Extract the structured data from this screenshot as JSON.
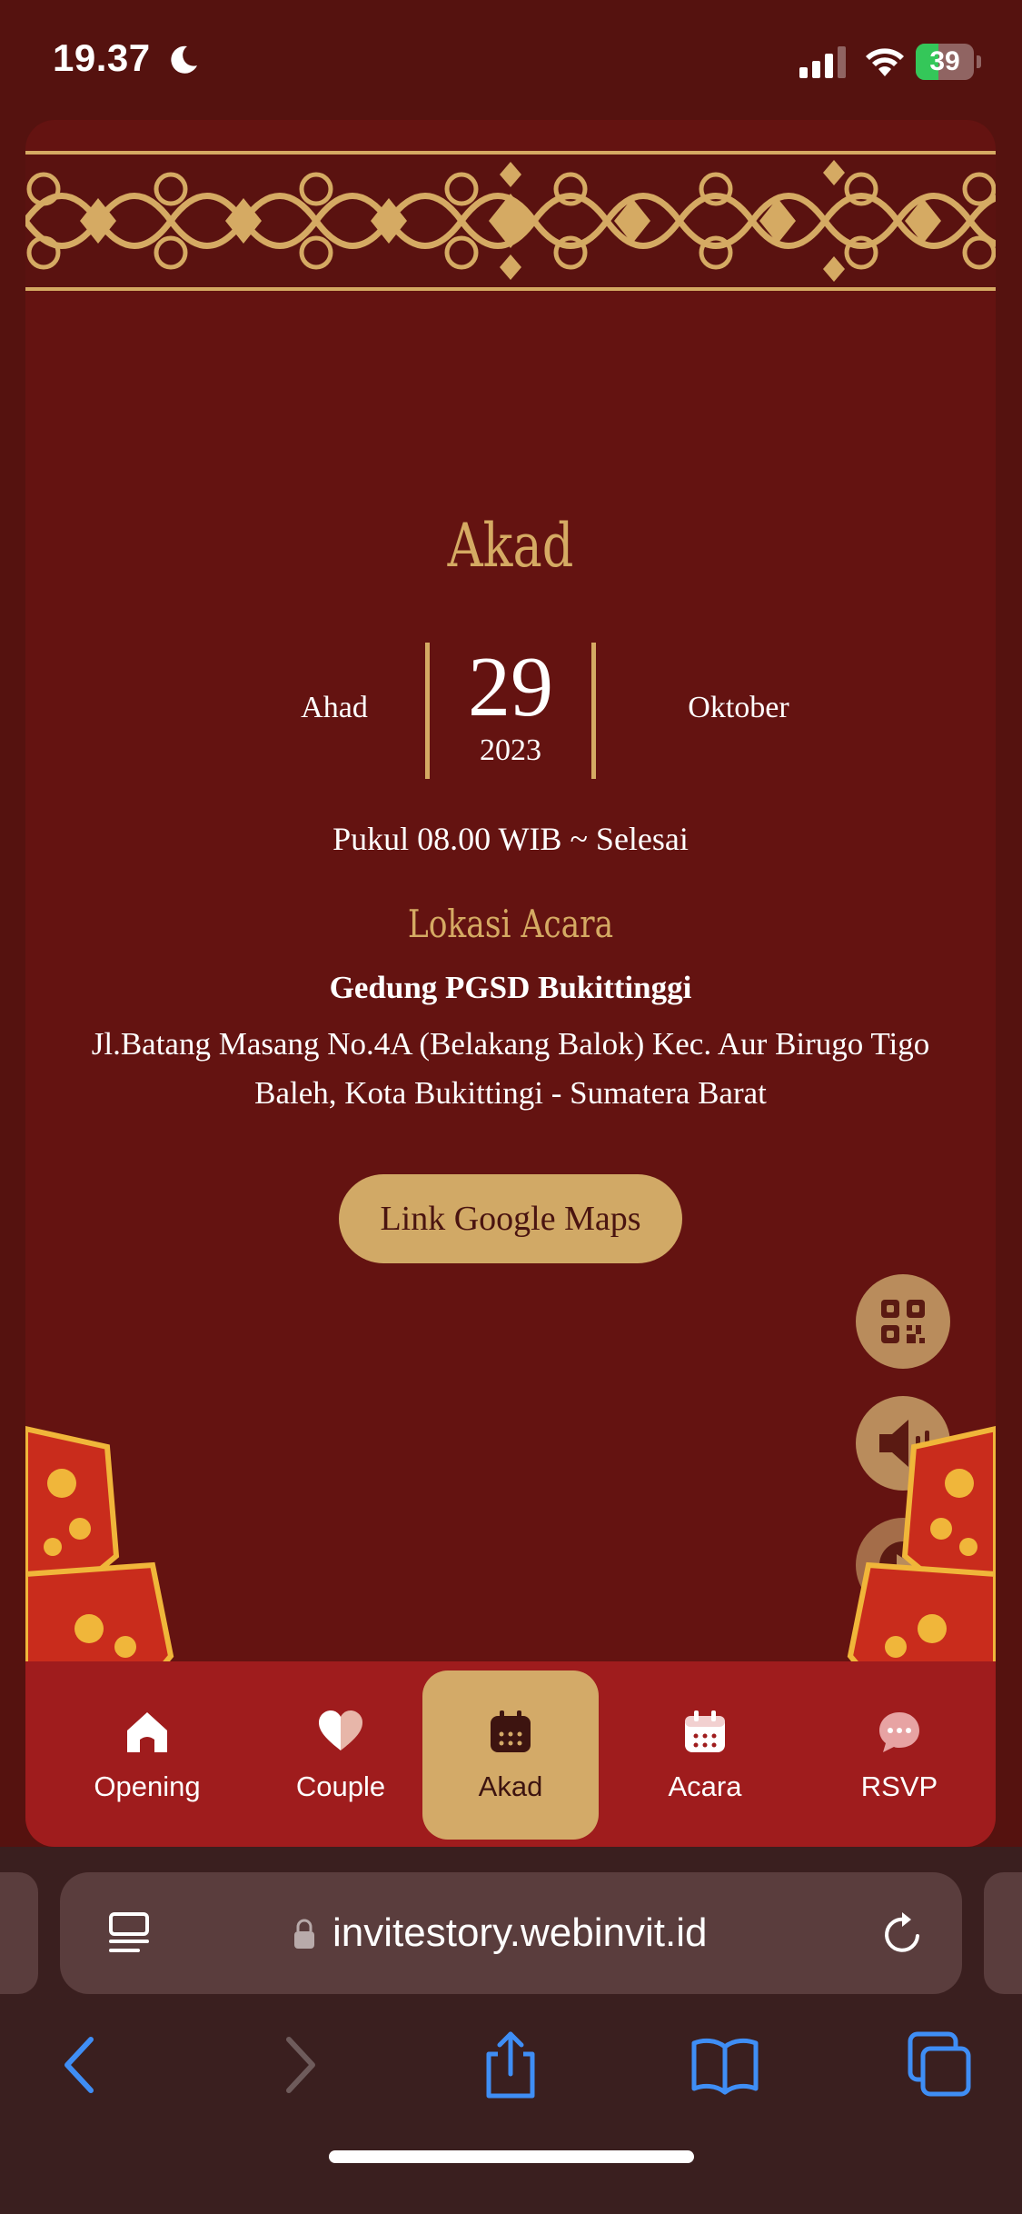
{
  "status_bar": {
    "time": "19.37",
    "battery": "39",
    "battery_level": 0.39
  },
  "page": {
    "title": "Akad",
    "day": "Ahad",
    "date": "29",
    "year": "2023",
    "month": "Oktober",
    "time_text": "Pukul 08.00 WIB ~ Selesai",
    "location_title": "Lokasi Acara",
    "venue": "Gedung PGSD Bukittinggi",
    "address": "Jl.Batang Masang No.4A (Belakang Balok) Kec. Aur Birugo Tigo Baleh, Kota Bukittingi - Sumatera Barat",
    "maps_button": "Link Google Maps"
  },
  "floating_buttons": [
    {
      "icon": "qr-code-icon"
    },
    {
      "icon": "speaker-icon"
    },
    {
      "icon": "play-icon"
    }
  ],
  "nav": {
    "items": [
      {
        "label": "Opening",
        "icon": "home-icon"
      },
      {
        "label": "Couple",
        "icon": "heart-icon"
      },
      {
        "label": "Akad",
        "icon": "calendar-icon",
        "active": true
      },
      {
        "label": "Acara",
        "icon": "calendar-icon"
      },
      {
        "label": "RSVP",
        "icon": "chat-bubble-icon"
      }
    ]
  },
  "browser": {
    "url": "invitestory.webinvit.id"
  },
  "colors": {
    "background": "#641311",
    "gold": "#d5aa63",
    "nav_bar": "#9f1c1d",
    "browser_chrome": "#3a1f1f",
    "toolbar_blue": "#3f8ef5"
  }
}
